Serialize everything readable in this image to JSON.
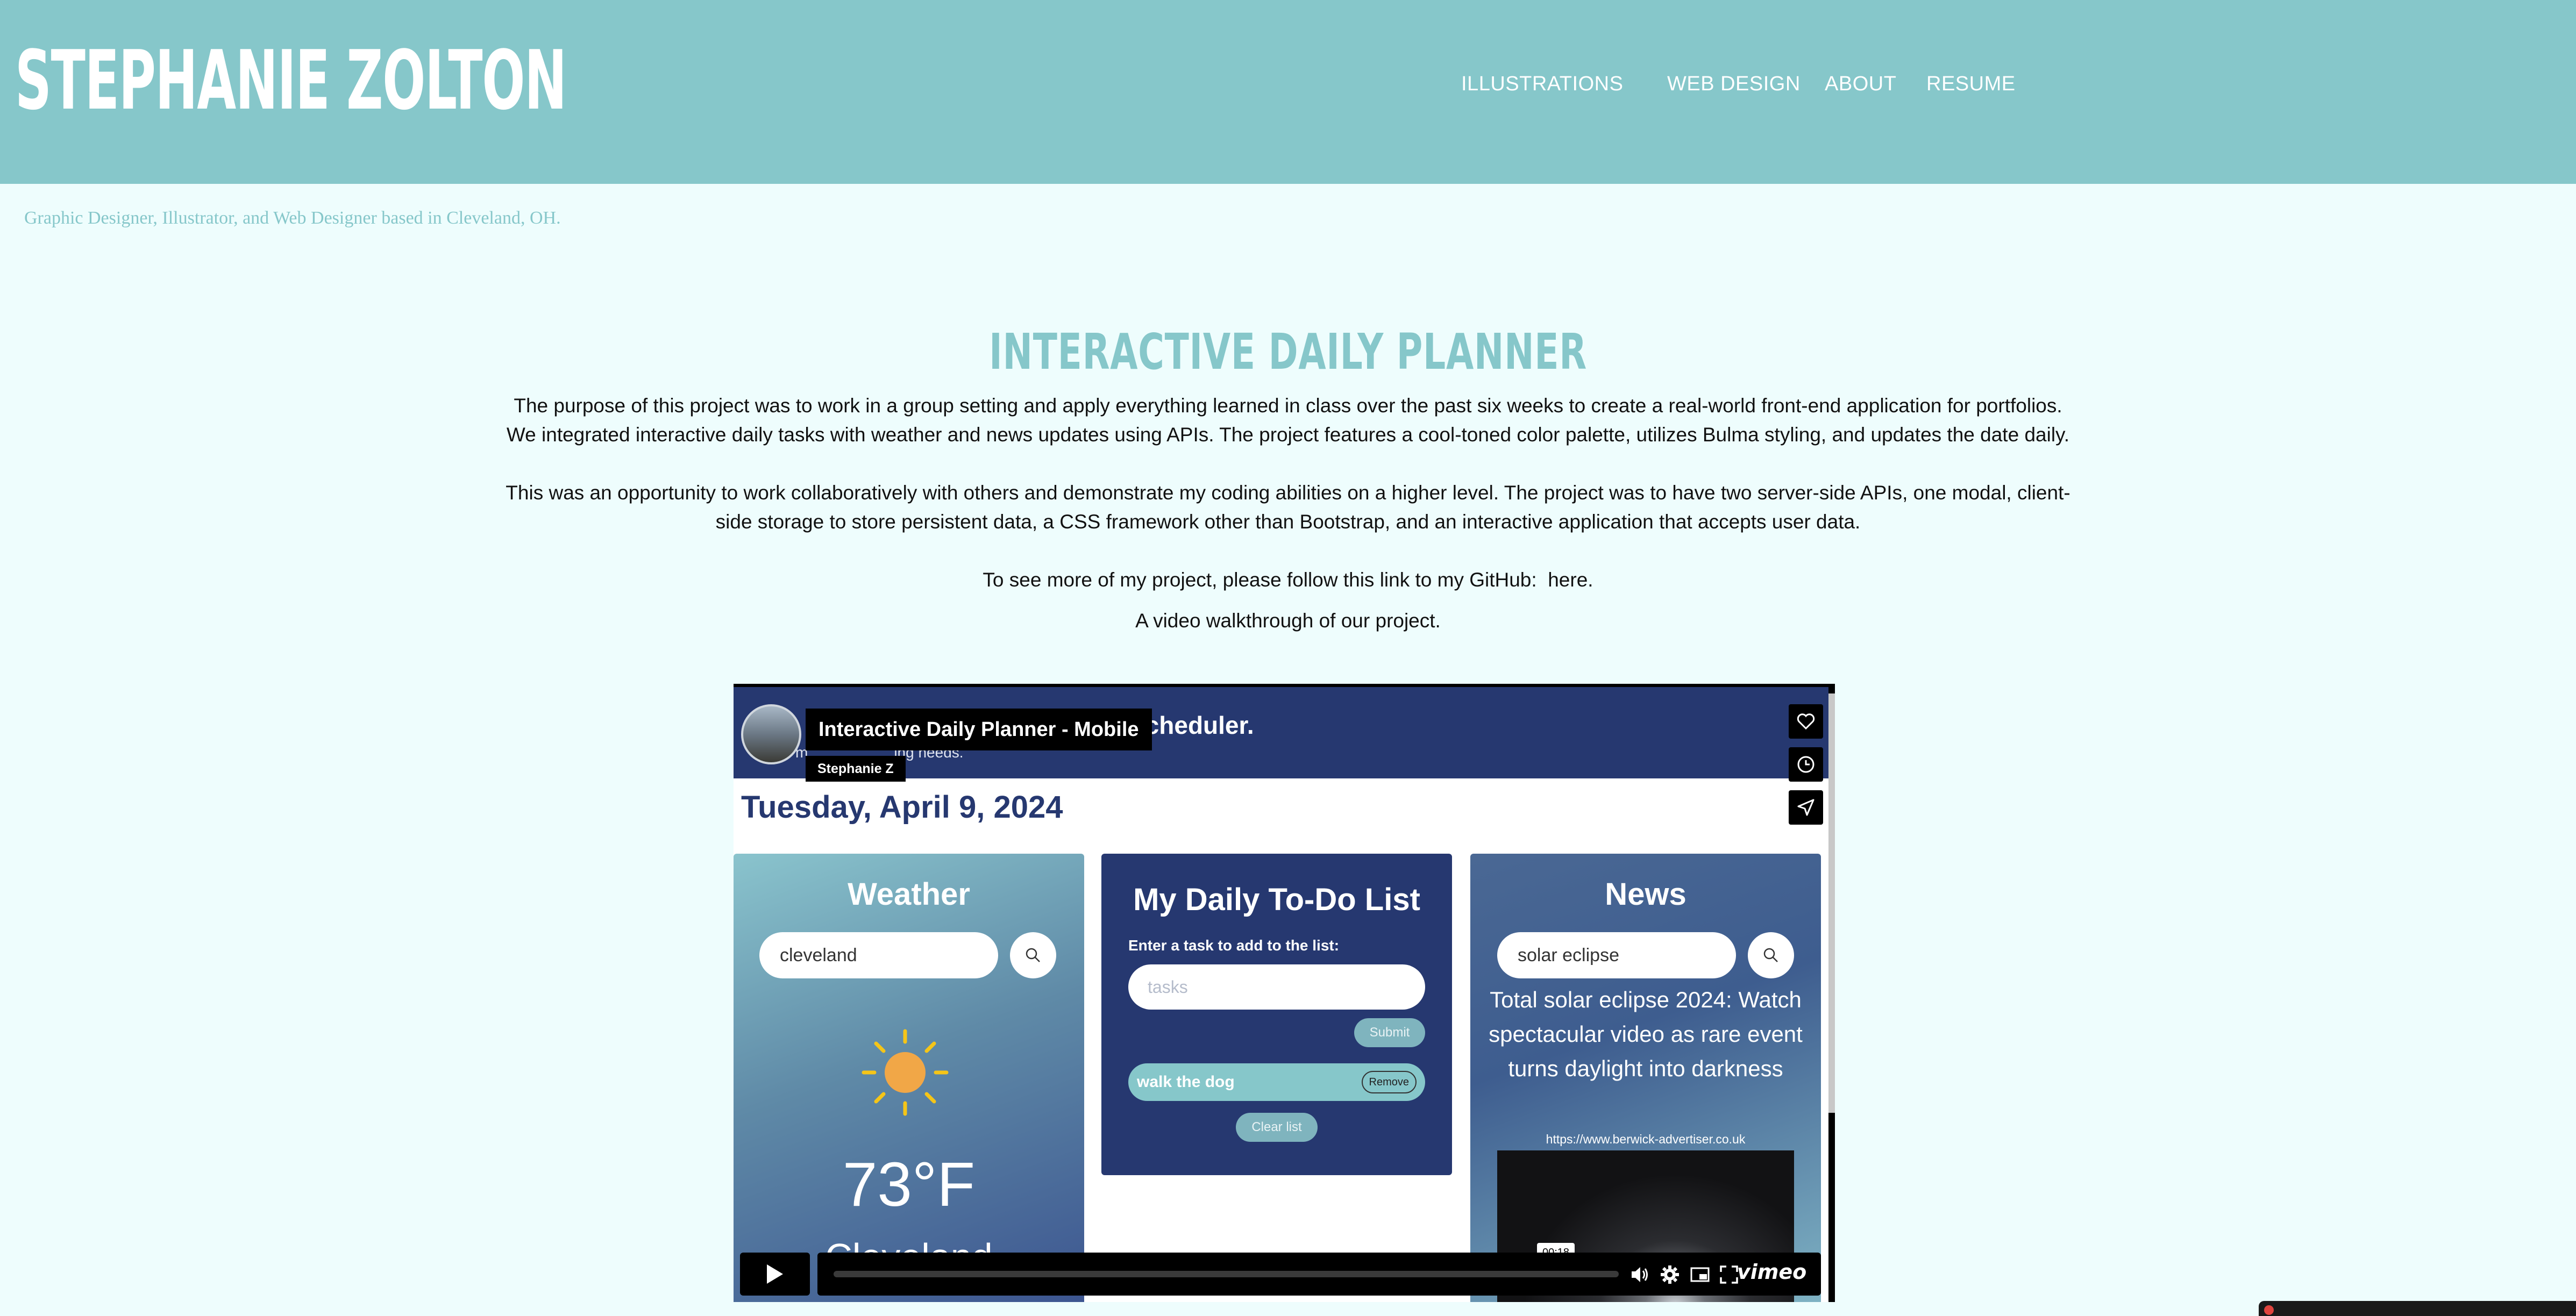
{
  "header": {
    "brand": "STEPHANIE ZOLTON",
    "nav": [
      {
        "label": "ILLUSTRATIONS"
      },
      {
        "label": "WEB DESIGN"
      },
      {
        "label": "ABOUT"
      },
      {
        "label": "RESUME"
      }
    ],
    "tagline": "Graphic Designer, Illustrator, and Web Designer based in Cleveland, OH."
  },
  "project": {
    "title": "INTERACTIVE DAILY PLANNER",
    "paragraph1": "The purpose of this project was to work in a group setting and apply everything learned in class over the past six weeks to create a real-world front-end application for portfolios. We integrated interactive daily tasks with weather and news updates using APIs. The project features a cool-toned color palette, utilizes Bulma styling, and updates the date daily.",
    "paragraph2": "This was an opportunity to work collaboratively with others and demonstrate my coding abilities on a higher level. The project was to have two server-side APIs, one modal, client-side storage to store persistent data, a CSS framework other than Bootstrap, and an interactive application that accepts user data.",
    "github_prefix": "To see more of my project, please follow this link to my GitHub:  ",
    "github_link": "here.",
    "video_caption": "A video walkthrough of our project."
  },
  "video": {
    "title": "Interactive Daily Planner - Mobile",
    "author": "Stephanie Z",
    "timestamp": "00:18",
    "progress": 0.0,
    "brand": "vimeo",
    "icons": [
      "heart-icon",
      "clock-icon",
      "send-icon",
      "play-icon",
      "volume-icon",
      "gear-icon",
      "pip-icon",
      "fullscreen-icon"
    ],
    "app": {
      "heading": "Scheduler.",
      "subheading_prefix": "m",
      "subheading": "ing needs.",
      "date": "Tuesday, April 9, 2024",
      "weather": {
        "title": "Weather",
        "search_value": "cleveland",
        "temperature": "73°F",
        "city": "Cleveland"
      },
      "todo": {
        "title": "My Daily To-Do List",
        "label": "Enter a task to add to the list:",
        "placeholder": "tasks",
        "submit": "Submit",
        "task": "walk the dog",
        "remove": "Remove",
        "clear": "Clear list"
      },
      "news": {
        "title": "News",
        "search_value": "solar eclipse",
        "headline": "Total solar eclipse 2024: Watch spectacular video as rare event turns daylight into darkness",
        "link": "https://www.berwick-advertiser.co.uk"
      }
    }
  },
  "colors": {
    "header_bg": "#86c7ca",
    "page_bg": "#eefdfd",
    "app_navy": "#263870"
  }
}
